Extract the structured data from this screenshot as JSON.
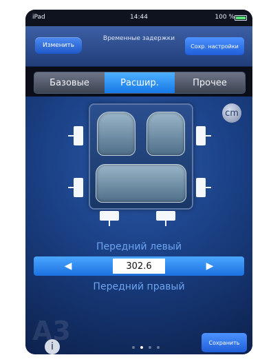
{
  "statusbar": {
    "device": "iPad",
    "time": "14:44",
    "battery_text": "100 %"
  },
  "nav": {
    "back_label": "Изменить",
    "title": "Временные задержки",
    "save_settings_label": "Сохр. настройки"
  },
  "tabs": [
    {
      "label": "Базовые"
    },
    {
      "label": "Расшир.",
      "active": true
    },
    {
      "label": "Прочее"
    }
  ],
  "main": {
    "unit_badge": "cm",
    "front_left_label": "Передний левый",
    "value": "302.6",
    "front_right_label": "Передний правый"
  },
  "footer": {
    "save_label": "Сохранить",
    "watermark_text": "A3",
    "page_dots_active": 1
  }
}
